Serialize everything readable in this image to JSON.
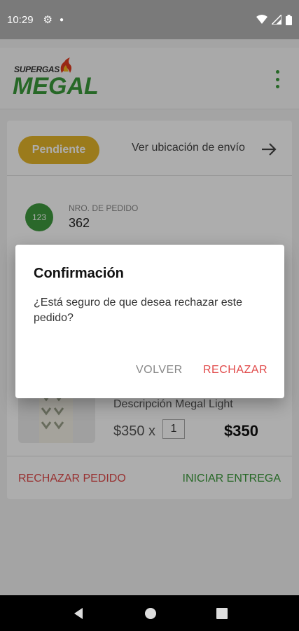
{
  "status_bar": {
    "time": "10:29"
  },
  "app": {
    "logo_small": "SUPERGAS",
    "logo_big": "MEGAL"
  },
  "order": {
    "status": "Pendiente",
    "ver_ubicacion": "Ver ubicación de envío",
    "badge": "123",
    "number_label": "NRO. DE PEDIDO",
    "number": "362"
  },
  "product": {
    "description": "Descripción Megal Light",
    "unit_price": "$350 x",
    "quantity": "1",
    "total": "$350"
  },
  "actions": {
    "reject": "RECHAZAR PEDIDO",
    "start": "INICIAR ENTREGA"
  },
  "dialog": {
    "title": "Confirmación",
    "body": "¿Está seguro de que desea rechazar este pedido?",
    "cancel": "VOLVER",
    "confirm": "RECHAZAR"
  },
  "colors": {
    "brand_green": "#3a9a3a",
    "pending_yellow": "#e5b52a",
    "reject_red": "#e14b4b"
  }
}
